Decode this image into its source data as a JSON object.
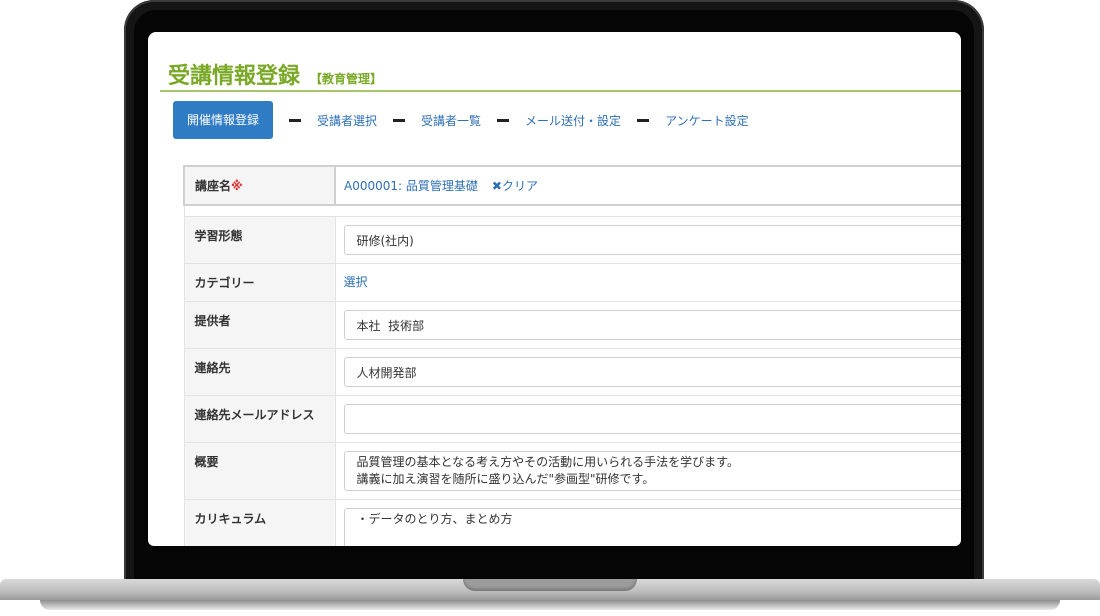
{
  "header": {
    "title": "受講情報登録",
    "subtitle": "【教育管理】"
  },
  "steps": [
    {
      "label": "開催情報登録",
      "active": true
    },
    {
      "label": "受講者選択"
    },
    {
      "label": "受講者一覧"
    },
    {
      "label": "メール送付・設定"
    },
    {
      "label": "アンケート設定"
    }
  ],
  "form": {
    "course": {
      "label": "講座名",
      "required_mark": "※",
      "value": "A000001: 品質管理基礎",
      "clear_icon": "✖",
      "clear_label": "クリア"
    },
    "learning_type": {
      "label": "学習形態",
      "value": "研修(社内)",
      "caret": "▼"
    },
    "category": {
      "label": "カテゴリー",
      "link": "選択"
    },
    "provider": {
      "label": "提供者",
      "value": "本社  技術部"
    },
    "contact": {
      "label": "連絡先",
      "value": "人材開発部"
    },
    "contact_email": {
      "label": "連絡先メールアドレス",
      "value": ""
    },
    "overview": {
      "label": "概要",
      "line1": "品質管理の基本となる考え方やその活動に用いられる手法を学びます。",
      "line2": "講義に加え演習を随所に盛り込んだ\"参画型\"研修です。"
    },
    "curriculum": {
      "label": "カリキュラム",
      "line1": "・データのとり方、まとめ方"
    }
  }
}
